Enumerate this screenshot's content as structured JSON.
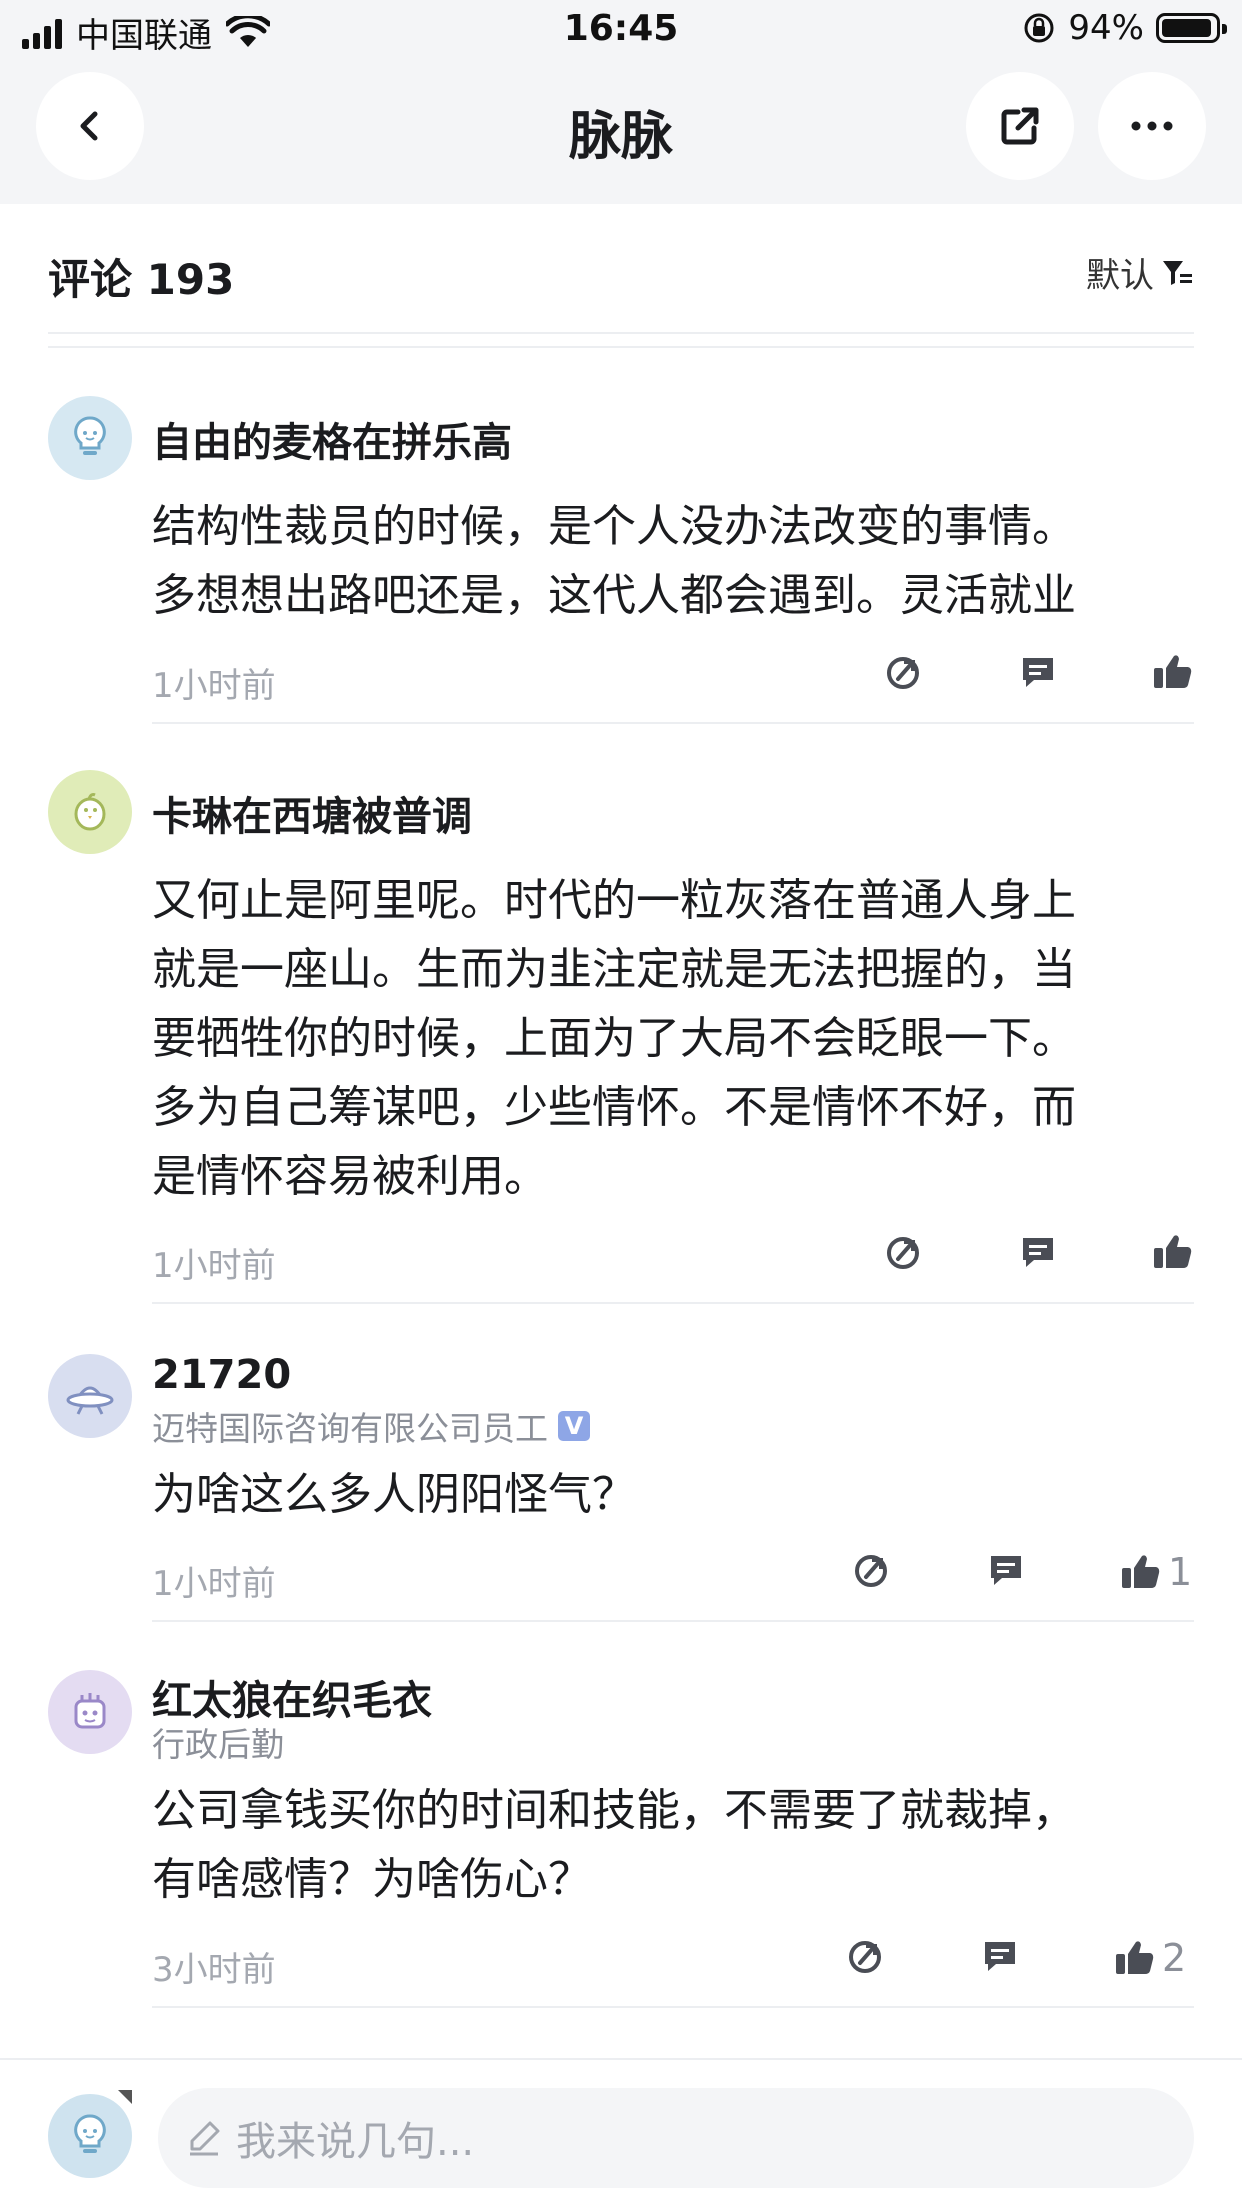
{
  "status_bar": {
    "carrier": "中国联通",
    "time": "16:45",
    "battery_percent": "94%",
    "battery_level": 0.94
  },
  "nav": {
    "title": "脉脉",
    "back_icon": "chevron-left-icon",
    "share_icon": "share-icon",
    "more_icon": "more-icon"
  },
  "comments_header": {
    "title": "评论 193",
    "sort_label": "默认",
    "sort_icon": "filter-icon"
  },
  "comments": [
    {
      "username": "自由的麦格在拼乐高",
      "subtitle": "",
      "text_lines": [
        "结构性裁员的时候，是个人没办法改变的事情。",
        "多想想出路吧还是，这代人都会遇到。灵活就业"
      ],
      "time": "1小时前",
      "likes": ""
    },
    {
      "username": "卡琳在西塘被普调",
      "subtitle": "",
      "text_lines": [
        "又何止是阿里呢。时代的一粒灰落在普通人身上",
        "就是一座山。生而为韭注定就是无法把握的，当",
        "要牺牲你的时候，上面为了大局不会眨眼一下。",
        "多为自己筹谋吧，少些情怀。不是情怀不好，而",
        "是情怀容易被利用。"
      ],
      "time": "1小时前",
      "likes": ""
    },
    {
      "username": "21720",
      "subtitle": "迈特国际咨询有限公司员工",
      "verified": "V",
      "text_lines": [
        "为啥这么多人阴阳怪气？"
      ],
      "time": "1小时前",
      "likes": "1"
    },
    {
      "username": "红太狼在织毛衣",
      "subtitle": "行政后勤",
      "text_lines": [
        "公司拿钱买你的时间和技能，不需要了就裁掉，",
        "有啥感情？为啥伤心？"
      ],
      "time": "3小时前",
      "likes": "2"
    }
  ],
  "input": {
    "placeholder": "我来说几句..."
  },
  "colors": {
    "nav_bg": "#f4f5f7",
    "text": "#1b1c1f",
    "muted": "#a4a8b0",
    "icon": "#4a4d55",
    "divider": "#eceef1",
    "verified": "#8ea6e6"
  }
}
